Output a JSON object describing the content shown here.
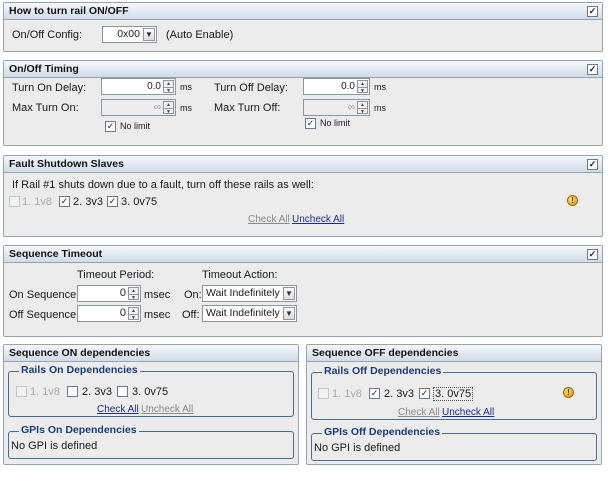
{
  "onoff": {
    "title": "How to turn rail ON/OFF",
    "config_label": "On/Off Config:",
    "config_value": "0x00",
    "config_note": "(Auto Enable)"
  },
  "timing": {
    "title": "On/Off Timing",
    "turn_on_delay_label": "Turn On Delay:",
    "turn_on_delay_value": "0.0",
    "turn_off_delay_label": "Turn Off Delay:",
    "turn_off_delay_value": "0.0",
    "max_turn_on_label": "Max Turn On:",
    "max_turn_on_value": "∞",
    "max_turn_off_label": "Max Turn Off:",
    "max_turn_off_value": "∞",
    "unit": "ms",
    "no_limit_label": "No limit"
  },
  "fault": {
    "title": "Fault Shutdown Slaves",
    "description": "If Rail #1 shuts down due to a fault, turn off these rails as well:",
    "rails": [
      {
        "label": "1. 1v8",
        "checked": false,
        "disabled": true
      },
      {
        "label": "2. 3v3",
        "checked": true,
        "disabled": false
      },
      {
        "label": "3. 0v75",
        "checked": true,
        "disabled": false
      }
    ],
    "check_all": "Check All",
    "uncheck_all": "Uncheck All"
  },
  "timeout": {
    "title": "Sequence Timeout",
    "period_header": "Timeout Period:",
    "action_header": "Timeout Action:",
    "on_seq_label": "On Sequence:",
    "on_seq_value": "0",
    "off_seq_label": "Off Sequence:",
    "off_seq_value": "0",
    "unit": "msec",
    "on_label": "On:",
    "on_action": "Wait Indefinitely",
    "off_label": "Off:",
    "off_action": "Wait Indefinitely"
  },
  "seq_on": {
    "title": "Sequence ON dependencies",
    "rails_title": "Rails On Dependencies",
    "rails": [
      {
        "label": "1. 1v8",
        "checked": false,
        "disabled": true
      },
      {
        "label": "2. 3v3",
        "checked": false,
        "disabled": false
      },
      {
        "label": "3. 0v75",
        "checked": false,
        "disabled": false
      }
    ],
    "check_all": "Check All",
    "uncheck_all": "Uncheck All",
    "gpi_title": "GPIs On Dependencies",
    "gpi_text": "No GPI is defined"
  },
  "seq_off": {
    "title": "Sequence OFF dependencies",
    "rails_title": "Rails Off Dependencies",
    "rails": [
      {
        "label": "1. 1v8",
        "checked": false,
        "disabled": true
      },
      {
        "label": "2. 3v3",
        "checked": true,
        "disabled": false
      },
      {
        "label": "3. 0v75",
        "checked": true,
        "disabled": false
      }
    ],
    "check_all": "Check All",
    "uncheck_all": "Uncheck All",
    "gpi_title": "GPIs Off Dependencies",
    "gpi_text": "No GPI is defined"
  },
  "colors": {
    "header_gradient_top": "#f6f9fc",
    "header_gradient_bottom": "#cfdbe8",
    "group_title": "#1a3d78",
    "link": "#1b2c95"
  },
  "icons": {
    "header_checkbox": "checkbox-checked-icon",
    "warning": "warning-icon",
    "spin": "spin-arrows-icon",
    "dropdown": "chevron-down-icon"
  }
}
